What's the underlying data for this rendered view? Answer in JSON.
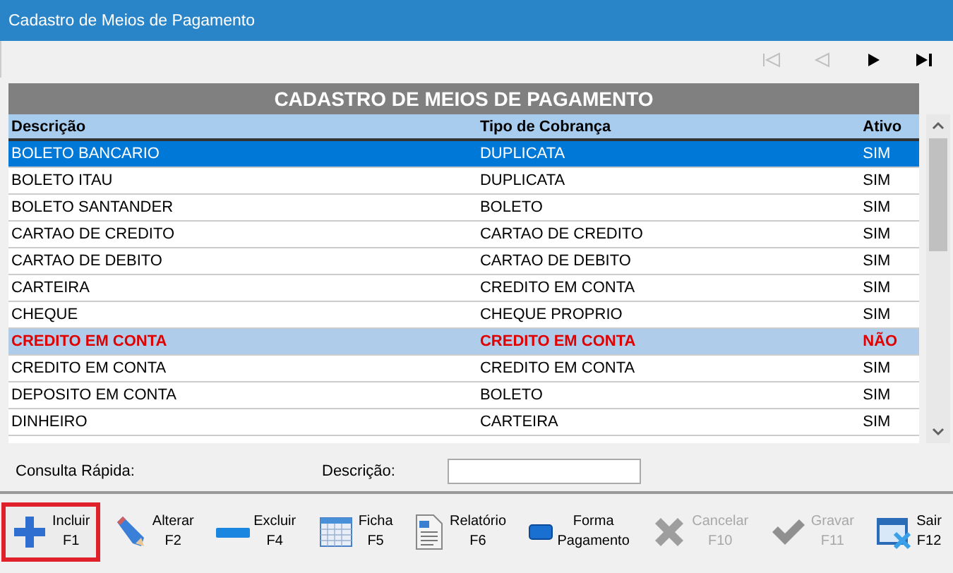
{
  "window": {
    "title": "Cadastro de Meios de Pagamento"
  },
  "navigation": [
    {
      "kind": "first",
      "disabled": true
    },
    {
      "kind": "prev",
      "disabled": true
    },
    {
      "kind": "next",
      "disabled": false
    },
    {
      "kind": "last",
      "disabled": false
    }
  ],
  "table": {
    "title": "CADASTRO DE MEIOS DE PAGAMENTO",
    "columns": [
      "Descrição",
      "Tipo de Cobrança",
      "Ativo"
    ],
    "rows": [
      {
        "cells": [
          "BOLETO BANCARIO",
          "DUPLICATA",
          "SIM"
        ],
        "selected": true,
        "inactive": false
      },
      {
        "cells": [
          "BOLETO ITAU",
          "DUPLICATA",
          "SIM"
        ],
        "selected": false,
        "inactive": false
      },
      {
        "cells": [
          "BOLETO SANTANDER",
          "BOLETO",
          "SIM"
        ],
        "selected": false,
        "inactive": false
      },
      {
        "cells": [
          "CARTAO DE CREDITO",
          "CARTAO DE CREDITO",
          "SIM"
        ],
        "selected": false,
        "inactive": false
      },
      {
        "cells": [
          "CARTAO DE DEBITO",
          "CARTAO DE DEBITO",
          "SIM"
        ],
        "selected": false,
        "inactive": false
      },
      {
        "cells": [
          "CARTEIRA",
          "CREDITO EM CONTA",
          "SIM"
        ],
        "selected": false,
        "inactive": false
      },
      {
        "cells": [
          "CHEQUE",
          "CHEQUE PROPRIO",
          "SIM"
        ],
        "selected": false,
        "inactive": false
      },
      {
        "cells": [
          "CREDITO EM CONTA",
          "CREDITO EM CONTA",
          "NÃO"
        ],
        "selected": false,
        "inactive": true
      },
      {
        "cells": [
          "CREDITO EM CONTA",
          "CREDITO EM CONTA",
          "SIM"
        ],
        "selected": false,
        "inactive": false
      },
      {
        "cells": [
          "DEPOSITO EM CONTA",
          "BOLETO",
          "SIM"
        ],
        "selected": false,
        "inactive": false
      },
      {
        "cells": [
          "DINHEIRO",
          "CARTEIRA",
          "SIM"
        ],
        "selected": false,
        "inactive": false
      }
    ]
  },
  "quick_search": {
    "label": "Consulta Rápida:",
    "field_label": "Descrição:"
  },
  "toolbar": [
    {
      "kind": "add",
      "lines": [
        "Incluir",
        "F1"
      ],
      "disabled": false,
      "focused": true
    },
    {
      "kind": "edit",
      "lines": [
        "Alterar",
        "F2"
      ],
      "disabled": false,
      "focused": false
    },
    {
      "kind": "remove",
      "lines": [
        "Excluir",
        "F4"
      ],
      "disabled": false,
      "focused": false
    },
    {
      "kind": "grid",
      "lines": [
        "Ficha",
        "F5"
      ],
      "disabled": false,
      "focused": false
    },
    {
      "kind": "report",
      "lines": [
        "Relatório",
        "F6"
      ],
      "disabled": false,
      "focused": false
    },
    {
      "kind": "payment",
      "lines": [
        "Forma",
        "Pagamento"
      ],
      "disabled": false,
      "focused": false
    },
    {
      "kind": "cancel",
      "lines": [
        "Cancelar",
        "F10"
      ],
      "disabled": true,
      "focused": false
    },
    {
      "kind": "save",
      "lines": [
        "Gravar",
        "F11"
      ],
      "disabled": true,
      "focused": false
    },
    {
      "kind": "exit",
      "lines": [
        "Sair",
        "F12"
      ],
      "disabled": false,
      "focused": false
    }
  ]
}
